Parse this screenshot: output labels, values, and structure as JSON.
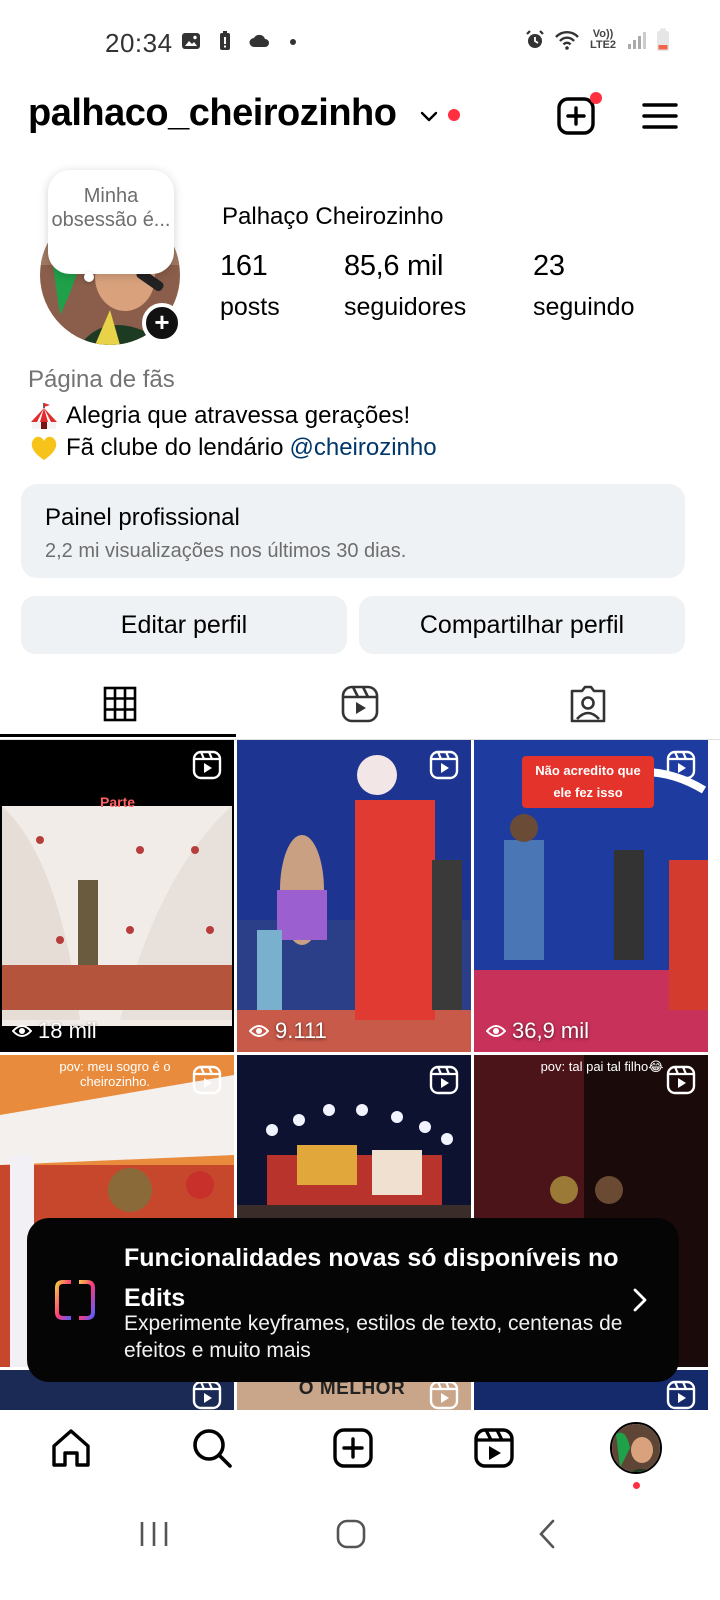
{
  "status_bar": {
    "time": "20:34",
    "network_label": "Vo)) LTE2"
  },
  "header": {
    "username": "palhaco_cheirozinho"
  },
  "profile": {
    "note": "Minha obsessão é...",
    "display_name": "Palhaço Cheirozinho",
    "stats": [
      {
        "value": "161",
        "label": "posts"
      },
      {
        "value": "85,6 mil",
        "label": "seguidores"
      },
      {
        "value": "23",
        "label": "seguindo"
      }
    ],
    "category": "Página de fãs",
    "bio_line1": "Alegria que atravessa gerações!",
    "bio_line2_prefix": "Fã clube do lendário",
    "bio_mention": "@cheirozinho"
  },
  "dashboard": {
    "title": "Painel profissional",
    "subtitle": "2,2 mi visualizações nos últimos 30 dias."
  },
  "actions": {
    "edit": "Editar perfil",
    "share": "Compartilhar perfil"
  },
  "tabs": [
    "grid-icon",
    "reels-icon",
    "tagged-icon"
  ],
  "grid": {
    "posts": [
      {
        "views": "18 mil",
        "overlay": "Parte"
      },
      {
        "views": "9.111",
        "overlay": ""
      },
      {
        "views": "36,9 mil",
        "overlay": "Não acredito que ele fez isso"
      },
      {
        "views": "",
        "overlay": "pov: meu sogro é o cheirozinho."
      },
      {
        "views": "",
        "overlay": ""
      },
      {
        "views": "",
        "overlay": "pov: tal pai tal filho😂"
      },
      {
        "views": "",
        "overlay": ""
      },
      {
        "views": "",
        "overlay": "O MELHOR"
      },
      {
        "views": "",
        "overlay": ""
      }
    ]
  },
  "banner": {
    "title": "Funcionalidades novas só disponíveis no Edits",
    "subtitle": "Experimente keyframes, estilos de texto, centenas de efeitos e muito mais"
  },
  "bottom_nav": [
    "home-icon",
    "search-icon",
    "create-icon",
    "reels-icon",
    "profile-avatar"
  ],
  "colors": {
    "notification_red": "#ff2f40",
    "mention_blue": "#00376b",
    "button_gray": "#eff2f5"
  }
}
